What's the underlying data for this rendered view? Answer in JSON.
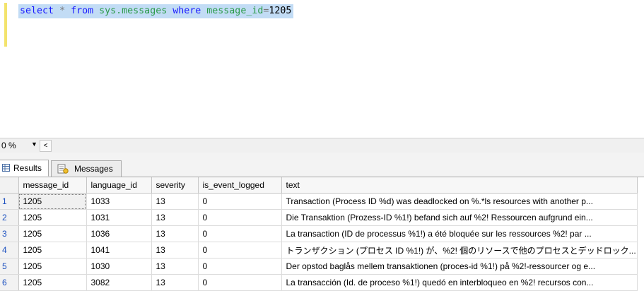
{
  "editor": {
    "query_tokens": {
      "select": "select",
      "star": "*",
      "from": "from",
      "object": "sys.messages",
      "where": "where",
      "column": "message_id",
      "equals": "=",
      "value": "1205"
    }
  },
  "zoom": {
    "value": "0 %",
    "arrow": "▼",
    "scroll_left": "<"
  },
  "tabs": [
    {
      "label": "Results",
      "icon": "grid-icon"
    },
    {
      "label": "Messages",
      "icon": "messages-icon"
    }
  ],
  "grid": {
    "columns": [
      "message_id",
      "language_id",
      "severity",
      "is_event_logged",
      "text"
    ],
    "rows": [
      {
        "num": "1",
        "cells": [
          "1205",
          "1033",
          "13",
          "0",
          "Transaction (Process ID %d) was deadlocked on %.*ls resources with another p..."
        ]
      },
      {
        "num": "2",
        "cells": [
          "1205",
          "1031",
          "13",
          "0",
          "Die Transaktion (Prozess-ID %1!) befand sich auf %2! Ressourcen aufgrund ein..."
        ]
      },
      {
        "num": "3",
        "cells": [
          "1205",
          "1036",
          "13",
          "0",
          "La transaction (ID de processus %1!) a été bloquée sur les ressources %2! par ..."
        ]
      },
      {
        "num": "4",
        "cells": [
          "1205",
          "1041",
          "13",
          "0",
          "トランザクション (プロセス ID %1!) が、%2! 個のリソースで他のプロセスとデッドロック..."
        ]
      },
      {
        "num": "5",
        "cells": [
          "1205",
          "1030",
          "13",
          "0",
          "Der opstod baglås mellem transaktionen (proces-id %1!) på %2!-ressourcer og e..."
        ]
      },
      {
        "num": "6",
        "cells": [
          "1205",
          "3082",
          "13",
          "0",
          "La transacción (Id. de proceso %1!) quedó en interbloqueo en %2! recursos con..."
        ]
      }
    ]
  }
}
